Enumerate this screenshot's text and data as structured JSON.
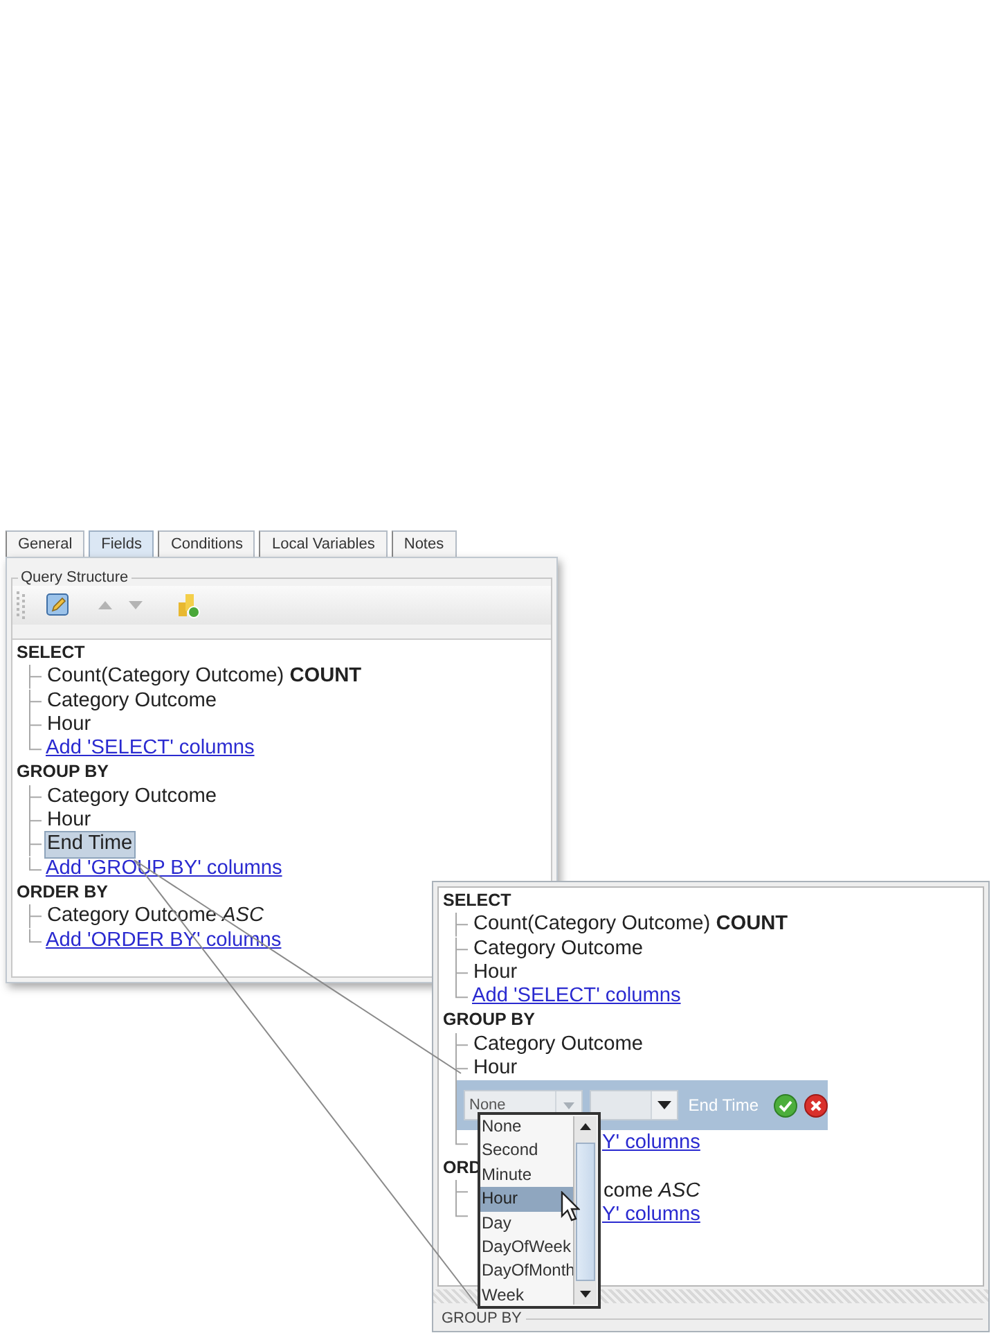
{
  "main_panel": {
    "tabs": [
      {
        "label": "General",
        "selected": false
      },
      {
        "label": "Fields",
        "selected": true
      },
      {
        "label": "Conditions",
        "selected": false
      },
      {
        "label": "Local Variables",
        "selected": false
      },
      {
        "label": "Notes",
        "selected": false
      }
    ],
    "group_title": "Query Structure",
    "tree": [
      {
        "label": "SELECT",
        "children": [
          {
            "kind": "field",
            "text": "Count(Category Outcome) **COUNT**",
            "selected": false
          },
          {
            "kind": "field",
            "text": "Category Outcome",
            "selected": false
          },
          {
            "kind": "field",
            "text": "Hour",
            "selected": false
          },
          {
            "kind": "link",
            "text": "Add 'SELECT' columns"
          }
        ]
      },
      {
        "label": "GROUP BY",
        "children": [
          {
            "kind": "field",
            "text": "Category Outcome",
            "selected": false
          },
          {
            "kind": "field",
            "text": "Hour",
            "selected": false
          },
          {
            "kind": "field",
            "text": "End Time",
            "selected": true
          },
          {
            "kind": "link",
            "text": "Add 'GROUP BY' columns"
          }
        ]
      },
      {
        "label": "ORDER BY",
        "children": [
          {
            "kind": "field",
            "text": "Category Outcome *ASC*",
            "selected": false
          },
          {
            "kind": "link",
            "text": "Add 'ORDER BY' columns"
          }
        ]
      }
    ]
  },
  "zoom_panel": {
    "tree": [
      {
        "label": "SELECT",
        "children": [
          {
            "kind": "field",
            "text": "Count(Category Outcome) **COUNT**",
            "selected": false
          },
          {
            "kind": "field",
            "text": "Category Outcome",
            "selected": false
          },
          {
            "kind": "field",
            "text": "Hour",
            "selected": false
          },
          {
            "kind": "link",
            "text": "Add 'SELECT' columns"
          }
        ]
      },
      {
        "label": "GROUP BY",
        "children": [
          {
            "kind": "field",
            "text": "Category Outcome",
            "selected": false
          },
          {
            "kind": "field",
            "text": "Hour",
            "selected": false
          },
          {
            "kind": "editor",
            "unit": "None",
            "label": "End Time"
          },
          {
            "kind": "link_fragment",
            "text": "Y' columns"
          }
        ]
      },
      {
        "label": "ORD",
        "children": [
          {
            "kind": "fragment",
            "text": "come *ASC*"
          },
          {
            "kind": "link_fragment",
            "text": "Y' columns"
          }
        ]
      }
    ],
    "dropdown": {
      "options": [
        {
          "label": "None",
          "selected": false
        },
        {
          "label": "Second",
          "selected": false
        },
        {
          "label": "Minute",
          "selected": false
        },
        {
          "label": "Hour",
          "selected": true
        },
        {
          "label": "Day",
          "selected": false
        },
        {
          "label": "DayOfWeek",
          "selected": false
        },
        {
          "label": "DayOfMonth",
          "selected": false
        },
        {
          "label": "Week",
          "selected": false
        }
      ]
    },
    "footer_title": "GROUP BY"
  }
}
